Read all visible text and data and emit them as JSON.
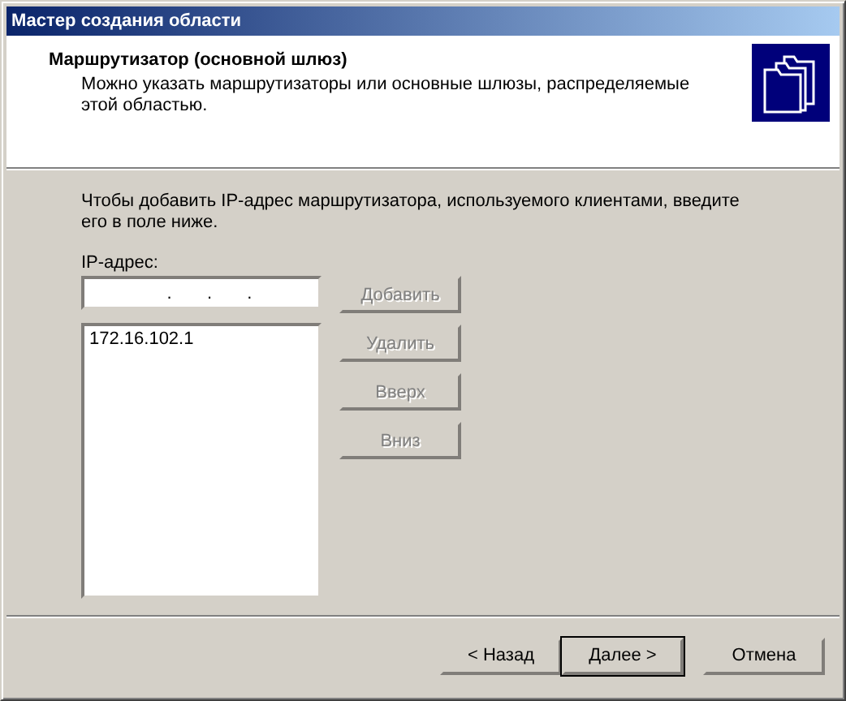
{
  "window": {
    "title": "Мастер создания области"
  },
  "header": {
    "title": "Маршрутизатор (основной шлюз)",
    "description": "Можно указать маршрутизаторы или основные шлюзы, распределяемые этой областью."
  },
  "instruction": "Чтобы добавить IP-адрес маршрутизатора, используемого клиентами, введите его в поле ниже.",
  "ip_field": {
    "label": "IP-адрес:",
    "separators": [
      ".",
      ".",
      "."
    ]
  },
  "addresses": [
    {
      "text": "172.16.102.1",
      "selected": false
    }
  ],
  "side_buttons": [
    {
      "label": "Добавить",
      "disabled": true
    },
    {
      "label": "Удалить",
      "disabled": true
    },
    {
      "label": "Вверх",
      "disabled": true
    },
    {
      "label": "Вниз",
      "disabled": true
    }
  ],
  "nav_buttons": [
    {
      "label": "< Назад",
      "default": false
    },
    {
      "label": "Далее >",
      "default": true
    },
    {
      "label": "Отмена",
      "default": false
    }
  ]
}
